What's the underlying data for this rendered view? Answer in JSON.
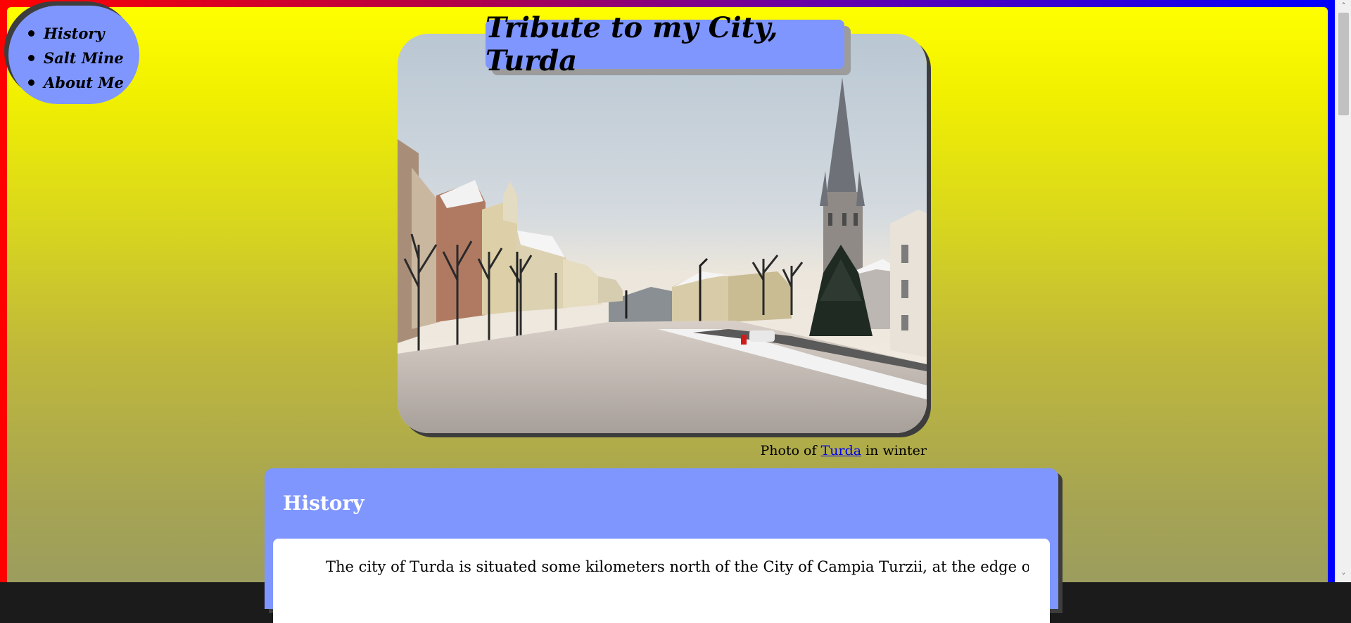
{
  "nav": {
    "items": [
      {
        "label": "History"
      },
      {
        "label": "Salt Mine"
      },
      {
        "label": "About Me"
      }
    ]
  },
  "header": {
    "title": "Tribute to my City, Turda"
  },
  "hero": {
    "caption_prefix": "Photo of ",
    "caption_link": "Turda",
    "caption_suffix": " in winter"
  },
  "history": {
    "heading": "History",
    "paragraph": "The city of Turda is situated some kilometers north of the City of Campia Turzii, at the edge of the Feleac"
  },
  "scrollbar": {
    "up_icon": "chevron-up-icon",
    "down_icon": "chevron-down-icon"
  },
  "colors": {
    "frame_left": "#ff0000",
    "frame_right": "#0000ff",
    "background_top": "#ffff00",
    "background_bottom": "#9c9d5e",
    "panel": "#7f96ff",
    "link": "#0000ee"
  }
}
